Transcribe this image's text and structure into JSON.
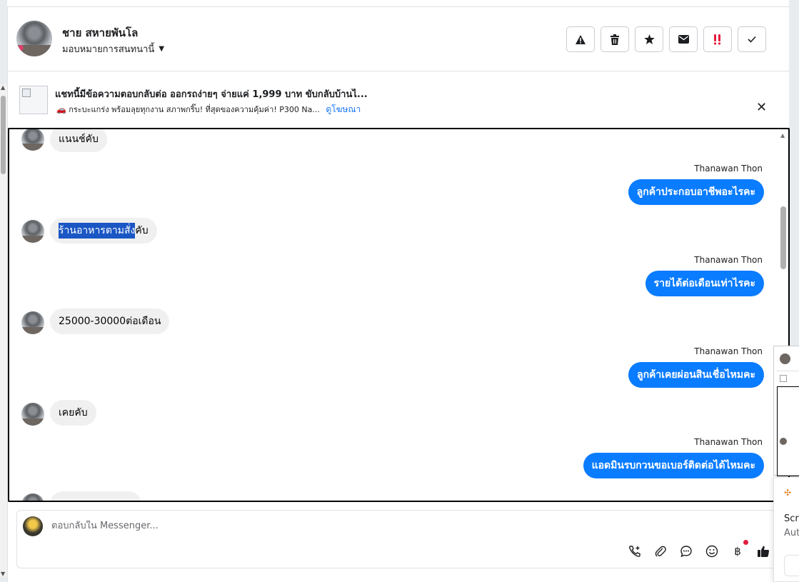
{
  "header": {
    "contact_name": "ชาย สหายพันโล",
    "assign_label": "มอบหมายการสนทนานี้",
    "actions": [
      {
        "name": "report-button",
        "glyph": "⚠"
      },
      {
        "name": "delete-button",
        "glyph": "🗑"
      },
      {
        "name": "star-button",
        "glyph": "★"
      },
      {
        "name": "mark-unread-button",
        "glyph": "✉"
      },
      {
        "name": "priority-button",
        "glyph": "‼"
      },
      {
        "name": "mark-done-button",
        "glyph": "✓"
      }
    ]
  },
  "ad": {
    "title": "แชทนี้มีข้อความตอบกลับต่อ ออกรถง่ายๆ จ่ายแค่ 1,999 บาท ขับกลับบ้านไ...",
    "subtitle": "🚗 กระบะแกร่ง พร้อมลุยทุกงาน สภาพกริ๊บ! ที่สุดของความคุ้มค่า! P300 Na...",
    "link": "ดูโฆษณา",
    "close": "✕"
  },
  "messages": {
    "m1": {
      "text": "แนนช์คับ"
    },
    "m2": {
      "sender": "Thanawan Thon",
      "text": "ลูกค้าประกอบอาชีพอะไรคะ"
    },
    "m3": {
      "highlight": "ร้านอาหารตามสั่ง",
      "rest": "คับ"
    },
    "m4": {
      "sender": "Thanawan Thon",
      "text": "รายได้ต่อเดือนเท่าไรคะ"
    },
    "m5": {
      "text": "25000-30000ต่อเดือน"
    },
    "m6": {
      "sender": "Thanawan Thon",
      "text": "ลูกค้าเคยผ่อนสินเชื่อไหมคะ"
    },
    "m7": {
      "text": "เคยคับ"
    },
    "m8": {
      "sender": "Thanawan Thon",
      "text": "แอดมินรบกวนขอเบอร์ติดต่อได้ไหมคะ"
    }
  },
  "composer": {
    "placeholder": "ตอบกลับใน Messenger..."
  },
  "toast": {
    "line1": "Scre",
    "line2": "Aut"
  }
}
